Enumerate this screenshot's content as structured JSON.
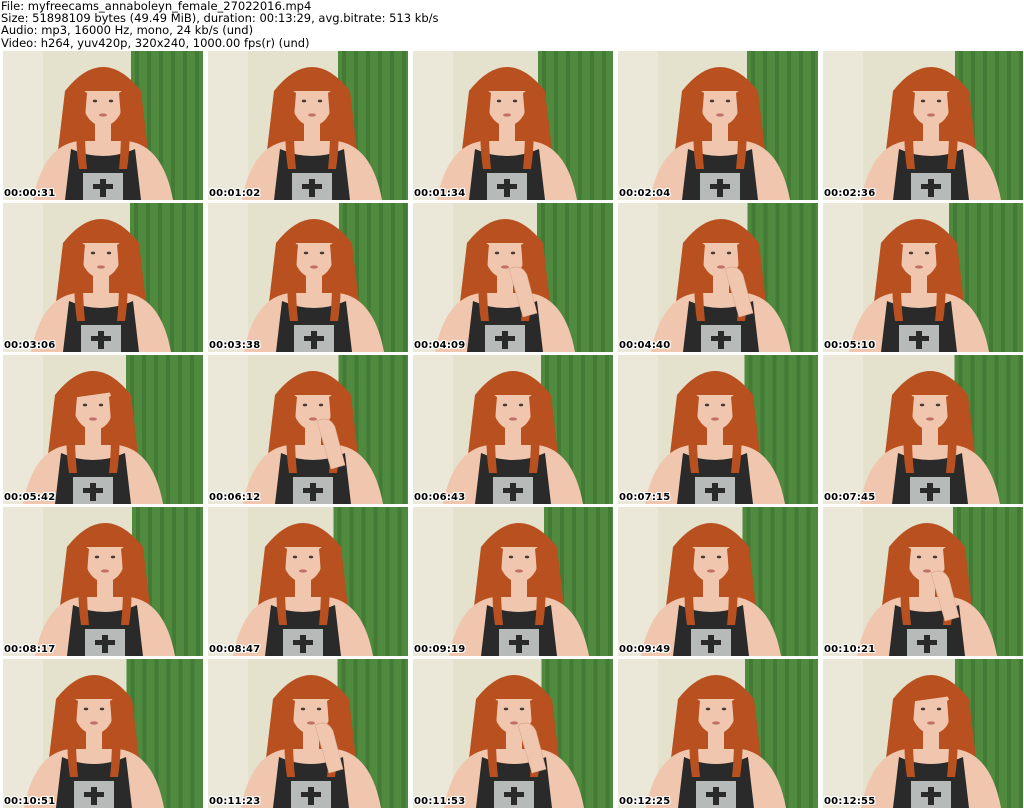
{
  "file_info": {
    "file_line": "File: myfreecams_annaboleyn_female_27022016.mp4",
    "size_line": "Size: 51898109 bytes (49.49 MiB), duration: 00:13:29, avg.bitrate: 513 kb/s",
    "audio_line": "Audio: mp3, 16000 Hz, mono, 24 kb/s (und)",
    "video_line": "Video: h264, yuv420p, 320x240, 1000.00 fps(r) (und)"
  },
  "colors": {
    "wall": "#e4e1cc",
    "curtain": "#4f8a3e",
    "curtain_dark": "#3c7030",
    "hair": "#b8501f",
    "skin": "#f0c7ae",
    "top": "#2a2a2a",
    "print": "#cfd3d2"
  },
  "thumbnails": [
    {
      "timestamp": "00:00:31",
      "pose": "neutral"
    },
    {
      "timestamp": "00:01:02",
      "pose": "neutral"
    },
    {
      "timestamp": "00:01:34",
      "pose": "neutral"
    },
    {
      "timestamp": "00:02:04",
      "pose": "neutral"
    },
    {
      "timestamp": "00:02:36",
      "pose": "neutral"
    },
    {
      "timestamp": "00:03:06",
      "pose": "neutral"
    },
    {
      "timestamp": "00:03:38",
      "pose": "neutral"
    },
    {
      "timestamp": "00:04:09",
      "pose": "hand"
    },
    {
      "timestamp": "00:04:40",
      "pose": "hand"
    },
    {
      "timestamp": "00:05:10",
      "pose": "neutral"
    },
    {
      "timestamp": "00:05:42",
      "pose": "tilt"
    },
    {
      "timestamp": "00:06:12",
      "pose": "hand"
    },
    {
      "timestamp": "00:06:43",
      "pose": "neutral"
    },
    {
      "timestamp": "00:07:15",
      "pose": "neutral"
    },
    {
      "timestamp": "00:07:45",
      "pose": "neutral"
    },
    {
      "timestamp": "00:08:17",
      "pose": "neutral"
    },
    {
      "timestamp": "00:08:47",
      "pose": "neutral"
    },
    {
      "timestamp": "00:09:19",
      "pose": "neutral"
    },
    {
      "timestamp": "00:09:49",
      "pose": "neutral"
    },
    {
      "timestamp": "00:10:21",
      "pose": "hand"
    },
    {
      "timestamp": "00:10:51",
      "pose": "neutral"
    },
    {
      "timestamp": "00:11:23",
      "pose": "hand"
    },
    {
      "timestamp": "00:11:53",
      "pose": "hand"
    },
    {
      "timestamp": "00:12:25",
      "pose": "neutral"
    },
    {
      "timestamp": "00:12:55",
      "pose": "tilt"
    }
  ]
}
